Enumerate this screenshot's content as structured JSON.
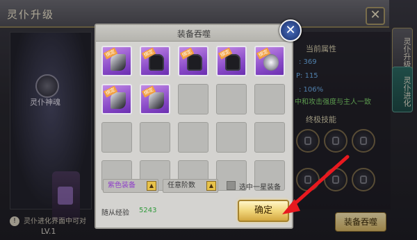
{
  "window": {
    "title": "灵仆升级",
    "close": "✕",
    "emblem_label": "灵仆神魂",
    "level": "LV.1",
    "bottom_note": "灵仆进化界面中可对",
    "bottom_button": "装备吞噬"
  },
  "side_tabs": [
    {
      "label": "灵仆升级",
      "active": true
    },
    {
      "label": "灵仆进化",
      "active": false
    }
  ],
  "attributes": {
    "header": "当前属性",
    "row1": ": 369",
    "row2": "P: 115",
    "row3": ": 106%",
    "note": "中和攻击强度与主人一致",
    "skills_header": "终极技能"
  },
  "modal": {
    "title": "装备吞噬",
    "close": "✕",
    "items": [
      {
        "type": "blade",
        "tag": "绑定"
      },
      {
        "type": "armor",
        "tag": "绑定"
      },
      {
        "type": "armor",
        "tag": "绑定"
      },
      {
        "type": "armor",
        "tag": "绑定"
      },
      {
        "type": "orb",
        "tag": "绑定"
      },
      {
        "type": "blade",
        "tag": "绑定"
      },
      {
        "type": "blade",
        "tag": "绑定"
      }
    ],
    "filter_purple": "紫色装备",
    "filter_level": "任意阶数",
    "filter_arrow": "▲",
    "checkbox_label": "选中一星装备",
    "exp_label": "随从经验",
    "exp_value": "5243",
    "confirm": "确定"
  },
  "colors": {
    "arrow": "#e8191f",
    "purple_label": "#8f3fc9",
    "exp_green": "#2f9a3a"
  }
}
